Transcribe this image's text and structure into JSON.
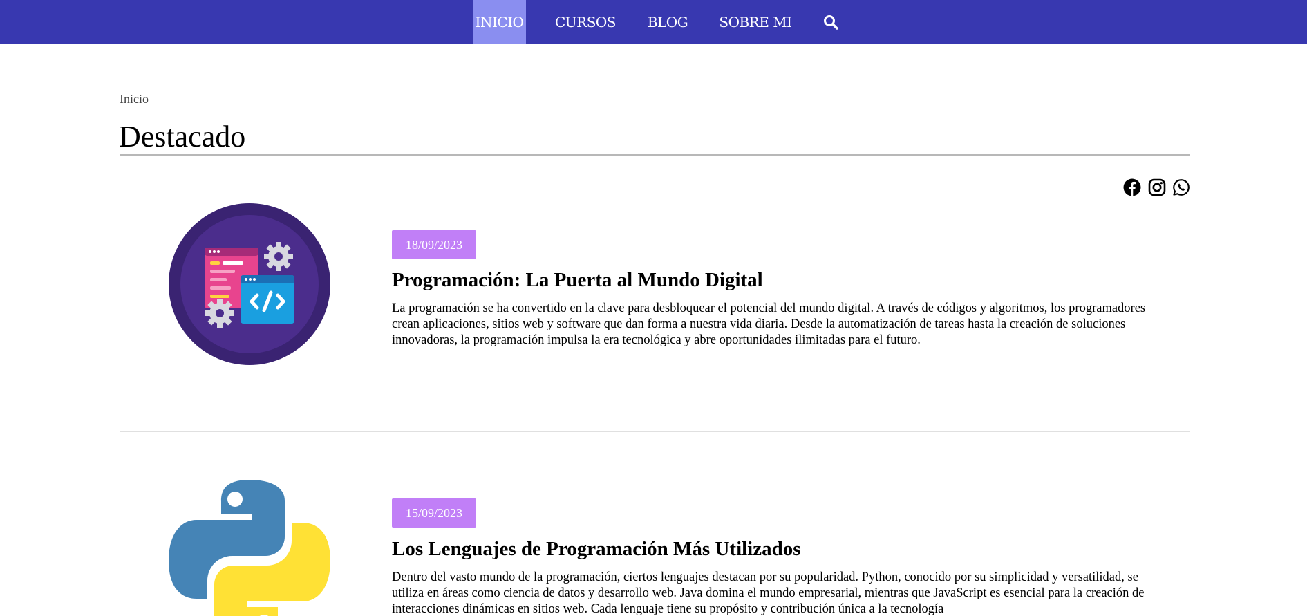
{
  "nav": {
    "items": [
      {
        "label": "INICIO",
        "active": true
      },
      {
        "label": "CURSOS",
        "active": false
      },
      {
        "label": "BLOG",
        "active": false
      },
      {
        "label": "SOBRE MI",
        "active": false
      }
    ],
    "search_icon": "search-icon",
    "colors": {
      "bar": "#3838b0",
      "active": "#8a8ef0"
    }
  },
  "breadcrumb": "Inicio",
  "page_title": "Destacado",
  "social": [
    "facebook-icon",
    "instagram-icon",
    "whatsapp-icon"
  ],
  "articles": [
    {
      "date": "18/09/2023",
      "title": "Programación: La Puerta al Mundo Digital",
      "text": "La programación se ha convertido en la clave para desbloquear el potencial del mundo digital. A través de códigos y algoritmos, los programadores crean aplicaciones, sitios web y software que dan forma a nuestra vida diaria. Desde la automatización de tareas hasta la creación de soluciones innovadoras, la programación impulsa la era tecnológica y abre oportunidades ilimitadas para el futuro.",
      "image_icon": "coding-window-icon"
    },
    {
      "date": "15/09/2023",
      "title": "Los Lenguajes de Programación Más Utilizados",
      "text": "Dentro del vasto mundo de la programación, ciertos lenguajes destacan por su popularidad. Python, conocido por su simplicidad y versatilidad, se utiliza en áreas como ciencia de datos y desarrollo web. Java domina el mundo empresarial, mientras que JavaScript es esencial para la creación de interacciones dinámicas en sitios web. Cada lenguaje tiene su propósito y contribución única a la tecnología",
      "image_icon": "python-logo-icon"
    }
  ],
  "accent_colors": {
    "badge": "#c17ff7"
  }
}
